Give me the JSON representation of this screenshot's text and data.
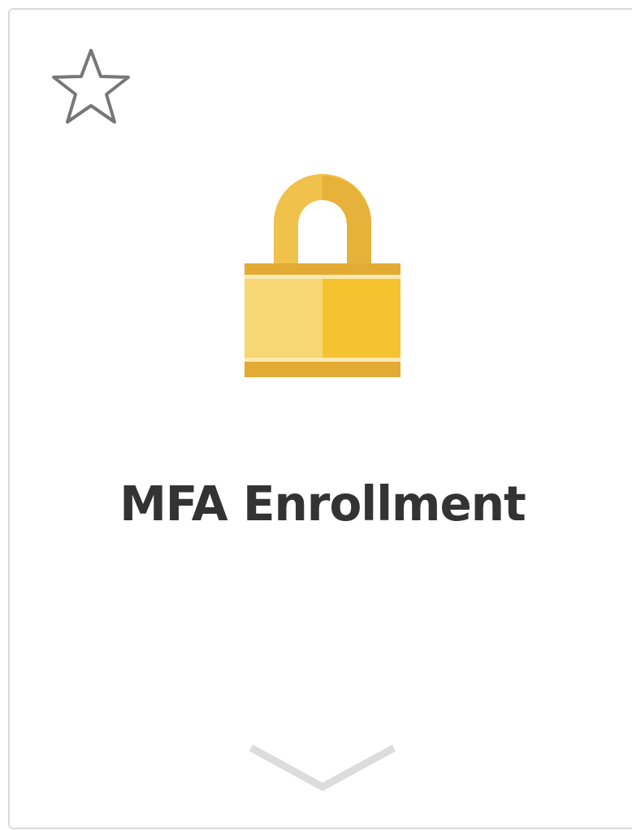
{
  "card": {
    "title": "MFA Enrollment",
    "favorite": false
  }
}
